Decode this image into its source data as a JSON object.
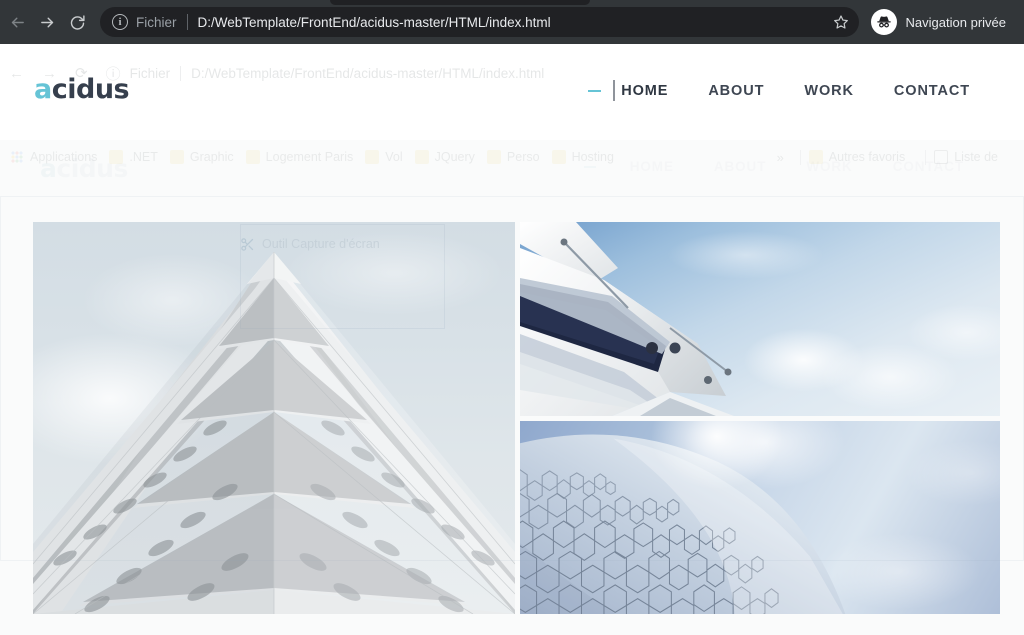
{
  "browser": {
    "back_icon": "back-arrow-icon",
    "forward_icon": "forward-arrow-icon",
    "reload_icon": "reload-icon",
    "info_icon": "info-circle-icon",
    "scheme_label": "Fichier",
    "url": "D:/WebTemplate/FrontEnd/acidus-master/HTML/index.html",
    "star_icon": "bookmark-star-icon",
    "profile_icon": "incognito-avatar-icon",
    "profile_label": "Navigation privée",
    "chrome_bg": "#323639",
    "omnibox_bg": "#202124"
  },
  "ghost_omnibox": {
    "back_icon": "back-arrow-icon",
    "forward_icon": "forward-arrow-icon",
    "reload_icon": "reload-icon",
    "info_icon": "info-circle-icon",
    "scheme_label": "Fichier",
    "url": "D:/WebTemplate/FrontEnd/acidus-master/HTML/index.html"
  },
  "ghost_bookmarks": {
    "items": [
      {
        "label": "Applications",
        "icon": "apps-grid-icon"
      },
      {
        "label": ".NET",
        "icon": "folder-icon"
      },
      {
        "label": "Graphic",
        "icon": "folder-icon"
      },
      {
        "label": "Logement Paris",
        "icon": "folder-icon"
      },
      {
        "label": "Vol",
        "icon": "folder-icon"
      },
      {
        "label": "JQuery",
        "icon": "folder-icon"
      },
      {
        "label": "Perso",
        "icon": "folder-icon"
      },
      {
        "label": "Hosting",
        "icon": "folder-icon"
      }
    ],
    "overflow_icon": "chevron-double-right-icon",
    "other_bookmarks": {
      "label": "Autres favoris",
      "icon": "folder-icon"
    },
    "reading_list": {
      "label": "Liste de",
      "icon": "reading-list-icon"
    }
  },
  "site": {
    "logo": {
      "accent": "a",
      "rest": "cidus",
      "accent_color": "#66c4d6",
      "rest_color": "#363f4d"
    },
    "nav": {
      "active_marker_color": "#66c4d6",
      "items": [
        {
          "label": "HOME",
          "active": true
        },
        {
          "label": "ABOUT",
          "active": false
        },
        {
          "label": "WORK",
          "active": false
        },
        {
          "label": "CONTACT",
          "active": false
        }
      ]
    }
  },
  "ghost_site_header": {
    "logo": {
      "accent": "a",
      "rest": "cidus"
    },
    "nav": {
      "items": [
        "HOME",
        "ABOUT",
        "WORK",
        "CONTACT"
      ]
    }
  },
  "ghost_snipping_tool": {
    "title": "Outil Capture d'écran",
    "icon": "scissors-icon"
  },
  "gallery": {
    "tiles": [
      {
        "id": "tile-tower",
        "alt": "faceted white concrete tower against pale sky",
        "position": "left-large"
      },
      {
        "id": "tile-canopy",
        "alt": "angular white canopy roof against blue cloudy sky",
        "position": "right-top"
      },
      {
        "id": "tile-dome",
        "alt": "hexagonal panelled dome against blue sky",
        "position": "right-bottom"
      }
    ]
  },
  "colors": {
    "page_bg": "#fafbfb",
    "header_bg": "#ffffff",
    "accent": "#66c4d6",
    "nav_text": "#3e4652"
  }
}
